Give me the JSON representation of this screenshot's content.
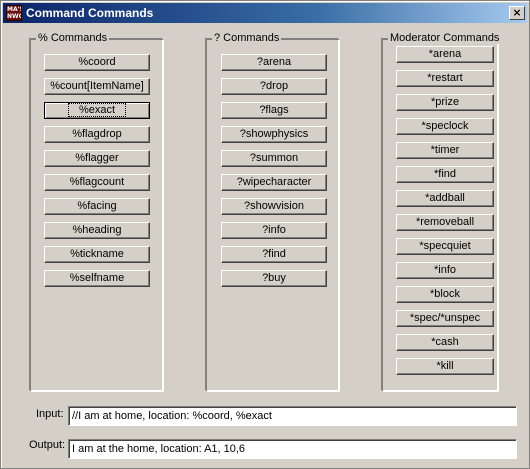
{
  "window": {
    "title": "Command Commands",
    "icon_text": "MA'SS NWO",
    "close_label": "×"
  },
  "groups": {
    "percent": {
      "label": "% Commands",
      "buttons": [
        "%coord",
        "%count[ItemName]",
        "%exact",
        "%flagdrop",
        "%flagger",
        "%flagcount",
        "%facing",
        "%heading",
        "%tickname",
        "%selfname"
      ]
    },
    "question": {
      "label": "? Commands",
      "buttons": [
        "?arena",
        "?drop",
        "?flags",
        "?showphysics",
        "?summon",
        "?wipecharacter",
        "?showvision",
        "?info",
        "?find",
        "?buy"
      ]
    },
    "moderator": {
      "label": "Moderator Commands",
      "buttons": [
        "*arena",
        "*restart",
        "*prize",
        "*speclock",
        "*timer",
        "*find",
        "*addball",
        "*removeball",
        "*specquiet",
        "*info",
        "*block",
        "*spec/*unspec",
        "*cash",
        "*kill"
      ]
    }
  },
  "input": {
    "label": "Input:",
    "value": "//I am at home, location: %coord, %exact"
  },
  "output": {
    "label": "Output:",
    "value": "I am at the home, location: A1, 10,6"
  }
}
